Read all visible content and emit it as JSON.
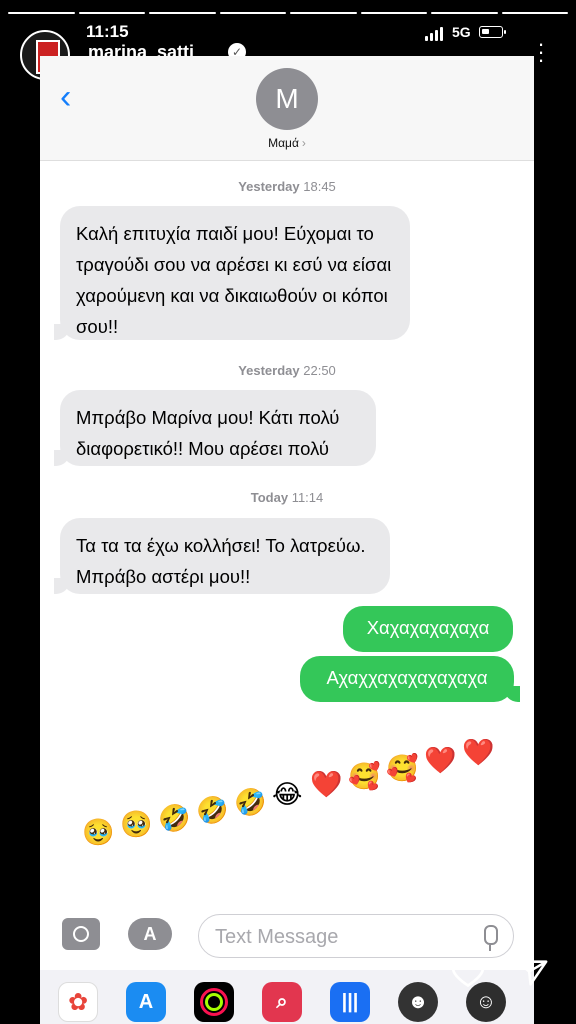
{
  "story": {
    "progress_segments": 8,
    "progress_done": 8,
    "username": "marina_satti"
  },
  "status_bar": {
    "time": "11:15",
    "network": "5G"
  },
  "conversation": {
    "back_icon": "chevron-left-icon",
    "contact_initial": "M",
    "contact_name": "Μαμά",
    "contact_chevron": "›",
    "stamps": [
      {
        "day": "Yesterday",
        "time": "18:45"
      },
      {
        "day": "Yesterday",
        "time": "22:50"
      },
      {
        "day": "Today",
        "time": "11:14"
      }
    ],
    "incoming": [
      "Καλή επιτυχία παιδί μου! Εύχομαι το τραγούδι σου να αρέσει κι εσύ να είσαι χαρούμενη και να δικαιωθούν οι κόποι σου!!",
      "Μπράβο Μαρίνα μου! Κάτι πολύ διαφορετικό!! Μου αρέσει πολύ",
      "Τα τα τα έχω κολλήσει! Το λατρεύω. Μπράβο αστέρι μου!!"
    ],
    "outgoing": [
      "Χαχαχαχαχαχα",
      "Αχαχχαχαχαχαχαχα"
    ],
    "emojis": [
      "🥹",
      "🥹",
      "🤣",
      "🤣",
      "🤣",
      "😂",
      "❤️",
      "🥰",
      "🥰",
      "❤️",
      "❤️"
    ]
  },
  "composer": {
    "placeholder": "Text Message",
    "camera_icon": "camera-icon",
    "apps_icon": "app-store-icon",
    "mic_icon": "microphone-icon"
  },
  "dock": {
    "apps": [
      "Photos",
      "App Store",
      "Fitness",
      "Search",
      "Voice Memos",
      "Memoji",
      "Memoji Stickers"
    ]
  },
  "colors": {
    "imessage_green": "#34c759",
    "incoming_gray": "#e9e9eb",
    "ios_blue": "#147efb"
  }
}
